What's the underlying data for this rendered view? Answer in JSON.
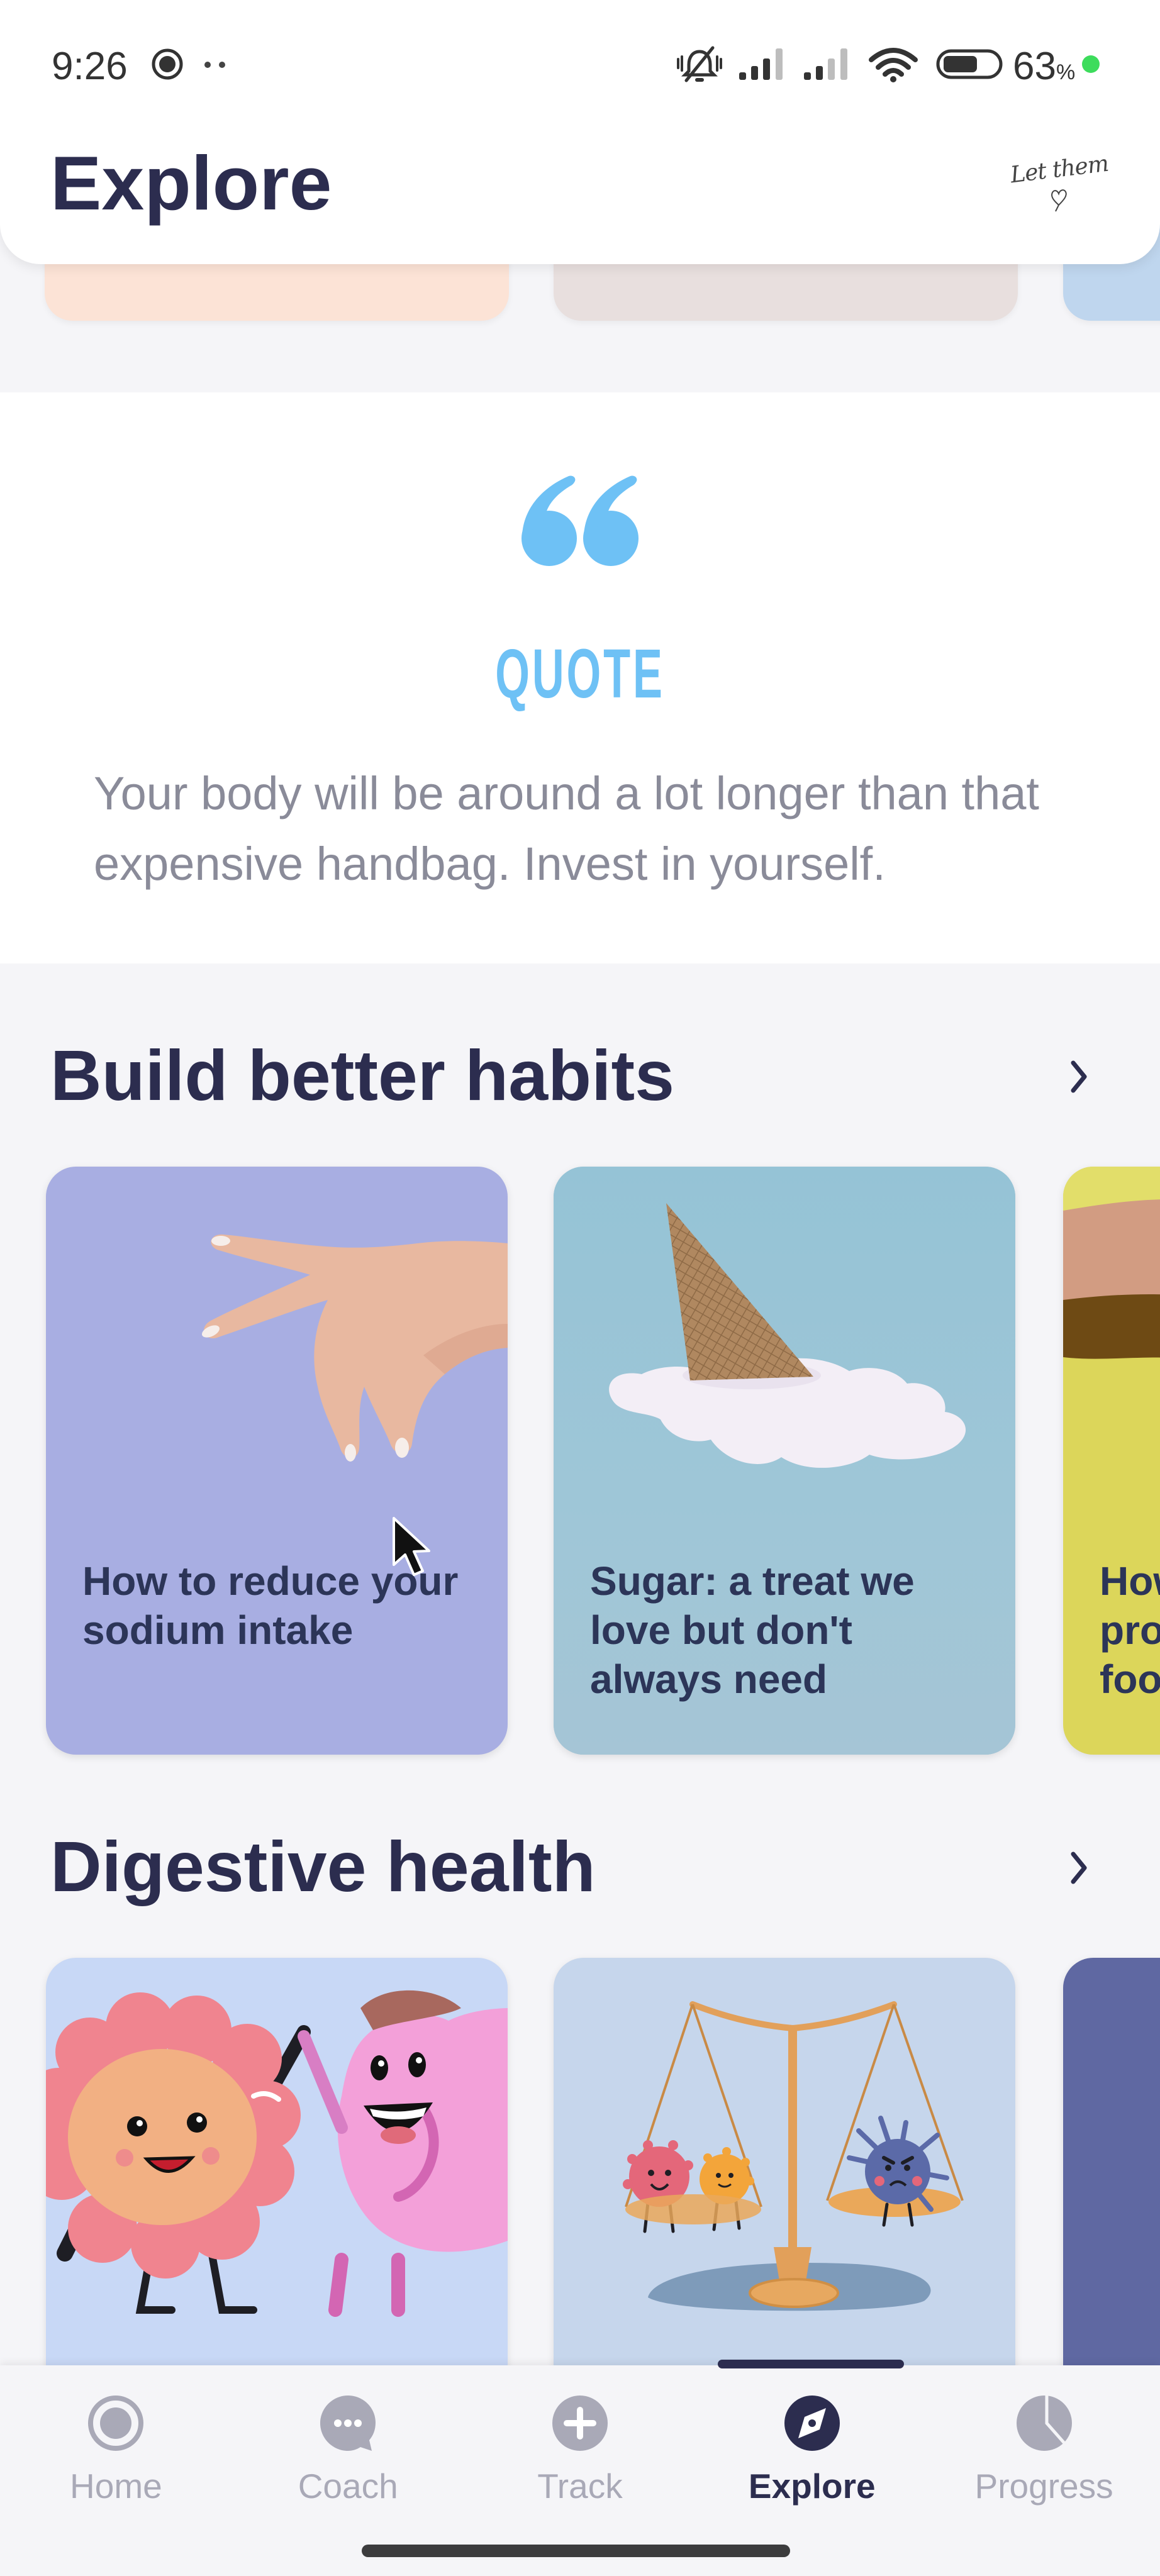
{
  "status_bar": {
    "time": "9:26",
    "battery_percent": "63",
    "battery_unit": "%",
    "battery_level": 0.63,
    "charging_dot_color": "#3DDC5C",
    "left_icons": [
      "screen-record-icon",
      "more-notifications-icon"
    ],
    "right_icons": [
      "silent-mode-icon",
      "signal-sim1-icon",
      "signal-sim2-icon",
      "wifi-icon",
      "battery-icon"
    ]
  },
  "header": {
    "title": "Explore",
    "signature": "Let them",
    "signature_icon": "heart-icon"
  },
  "top_carousel": {
    "cards": [
      {
        "color": "#FCE3D6"
      },
      {
        "color": "#E8DFDE"
      },
      {
        "color": "#BFD6EE"
      }
    ]
  },
  "quote": {
    "icon": "quote-mark-icon",
    "label": "QUOTE",
    "text": "Your body will be around a lot longer than that expensive handbag. Invest in yourself.",
    "accent_color": "#6EC1F5"
  },
  "sections": [
    {
      "title": "Build better habits",
      "more_icon": "chevron-right-icon",
      "cards": [
        {
          "title": "How to reduce your sodium intake",
          "color": "#A8AEE2",
          "illustration": "hand-pinching"
        },
        {
          "title": "Sugar: a treat we love but don't always need",
          "color": "#A3C6D7",
          "illustration": "melted-ice-cream-cone"
        },
        {
          "title_lines": [
            "How",
            "pro",
            "foo"
          ],
          "color": "#DCD65A",
          "illustration": "arm-with-bracelet"
        }
      ]
    },
    {
      "title": "Digestive health",
      "more_icon": "chevron-right-icon",
      "cards": [
        {
          "color": "#C8D8F6",
          "illustration": "gut-and-stomach-high-five"
        },
        {
          "color": "#C6D6EC",
          "illustration": "bacteria-balance-scale"
        },
        {
          "color": "#5F68A2",
          "illustration": ""
        }
      ]
    }
  ],
  "bottom_nav": {
    "active_color": "#2C2D4F",
    "inactive_color": "#A9A9B7",
    "items": [
      {
        "label": "Home",
        "icon": "home-icon",
        "active": false
      },
      {
        "label": "Coach",
        "icon": "coach-chat-icon",
        "active": false
      },
      {
        "label": "Track",
        "icon": "track-plus-icon",
        "active": false
      },
      {
        "label": "Explore",
        "icon": "explore-compass-icon",
        "active": true
      },
      {
        "label": "Progress",
        "icon": "progress-pie-icon",
        "active": false
      }
    ]
  },
  "colors": {
    "background": "#F5F5F8",
    "text_primary": "#2C2D4F",
    "card_title": "#2C3558",
    "quote_text": "#8A8B99"
  }
}
